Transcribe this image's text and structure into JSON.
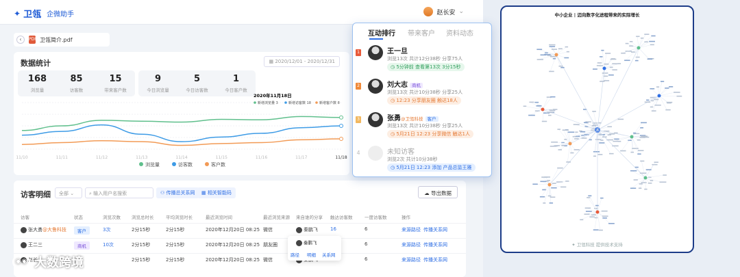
{
  "app": {
    "brand": "卫瓴",
    "product": "企微助手",
    "user_name": "赵长安"
  },
  "file": {
    "name": "卫瓴简介.pdf",
    "back": "‹",
    "pdf_label": "PDF"
  },
  "stats": {
    "title": "数据统计",
    "date_range": "2020/12/01 - 2020/12/31",
    "kpis_total": [
      {
        "num": "168",
        "label": "浏览量"
      },
      {
        "num": "85",
        "label": "访客数"
      },
      {
        "num": "15",
        "label": "带来客户数"
      }
    ],
    "kpis_today": [
      {
        "num": "9",
        "label": "今日浏览量"
      },
      {
        "num": "5",
        "label": "今日访客数"
      },
      {
        "num": "1",
        "label": "今日客户数"
      }
    ]
  },
  "chart_data": {
    "type": "line",
    "x": [
      "11/10",
      "11/11",
      "11/12",
      "11/13",
      "11/14",
      "11/15",
      "11/16",
      "11/17",
      "11/18"
    ],
    "tooltip_date": "2020年11月18日",
    "tooltip_items": [
      "新增浏览量 3",
      "新增访客数 18",
      "新增客户数 8"
    ],
    "series": [
      {
        "name": "浏览量",
        "color": "#5fbf8c",
        "values": [
          40,
          50,
          62,
          60,
          58,
          64,
          63,
          70,
          68
        ]
      },
      {
        "name": "访客数",
        "color": "#3d9be6",
        "values": [
          30,
          38,
          52,
          32,
          16,
          26,
          34,
          46,
          50
        ]
      },
      {
        "name": "客户数",
        "color": "#f29a55",
        "values": [
          10,
          14,
          18,
          16,
          8,
          12,
          14,
          20,
          22
        ]
      }
    ],
    "ylim": [
      0,
      100
    ],
    "grid": true,
    "legend": "bottom"
  },
  "visitors": {
    "title": "访客明细",
    "filter_all": "全部",
    "search_placeholder": "输入用户名搜索",
    "btn_relation": "传播总关系网",
    "btn_qr": "相关智能码",
    "btn_export": "导出数据",
    "columns": [
      "访客",
      "状态",
      "浏览次数",
      "浏览总时长",
      "平均浏览时长",
      "最近浏览时间",
      "最近浏览来源",
      "来自谁的分享",
      "触达访客数",
      "一度访客数",
      "操作"
    ],
    "rows": [
      {
        "name": "张大勇",
        "company": "@大鲁科技",
        "status": "客户",
        "times": "3次",
        "total": "2分15秒",
        "avg": "2分15秒",
        "last": "2020年12月20日 08:25",
        "source": "微信",
        "sharer": "秦鹏飞",
        "reach": "16",
        "first": "6",
        "op1": "来源路径",
        "op2": "传播关系网"
      },
      {
        "name": "王二三",
        "company": "",
        "status": "商机",
        "times": "10次",
        "total": "2分15秒",
        "avg": "2分15秒",
        "last": "2020年12月20日 08:25",
        "source": "朋友圈",
        "sharer": "秦鹏飞",
        "reach": "16",
        "first": "6",
        "op1": "来源路径",
        "op2": "传播关系网"
      },
      {
        "name": "赵长",
        "company": "",
        "status": "",
        "times": "",
        "total": "2分15秒",
        "avg": "2分15秒",
        "last": "2020年12月20日 08:25",
        "source": "微信",
        "sharer": "秦鹏飞",
        "reach": "",
        "first": "6",
        "op1": "来源路径",
        "op2": "传播关系网"
      }
    ],
    "popover": {
      "name": "秦鹏飞",
      "links": [
        "路径",
        "明细",
        "关系网"
      ]
    }
  },
  "ranking": {
    "tabs": [
      "互动排行",
      "带来客户",
      "资料动态"
    ],
    "items": [
      {
        "rank": "1",
        "name": "王一旦",
        "badge": "",
        "meta": "浏览13次  共计12分38秒  分享75人",
        "pill": "5分钟前 查看第13次  3分15秒",
        "pill_type": "green",
        "rank_color": "#e85a3a"
      },
      {
        "rank": "2",
        "name": "刘大志",
        "badge": "商机",
        "meta": "浏览13次  共计10分38秒  分享25人",
        "pill": "12:23  分享朋友圈  触达18人",
        "pill_type": "orange",
        "rank_color": "#f08a3a"
      },
      {
        "rank": "3",
        "name": "张勇",
        "badge": "客户",
        "company": "@卫瓴科技",
        "meta": "浏览13次  共计10分38秒  分享25人",
        "pill": "5月21日 12:23  分享微信  触达1人",
        "pill_type": "orange",
        "rank_color": "#f2b860"
      },
      {
        "rank": "4",
        "name": "未知访客",
        "badge": "",
        "meta": "浏览2次  共计10分38秒",
        "pill": "5月21日 12:23  添加 产品总监王雅",
        "pill_type": "blue",
        "rank_color": "#ccc"
      }
    ]
  },
  "network": {
    "title": "中小企业 | 迈向数字化进程带来的实际增长",
    "footer": "卫瓴科技 提供技术支持"
  },
  "watermark": {
    "text": "大数跨境"
  }
}
